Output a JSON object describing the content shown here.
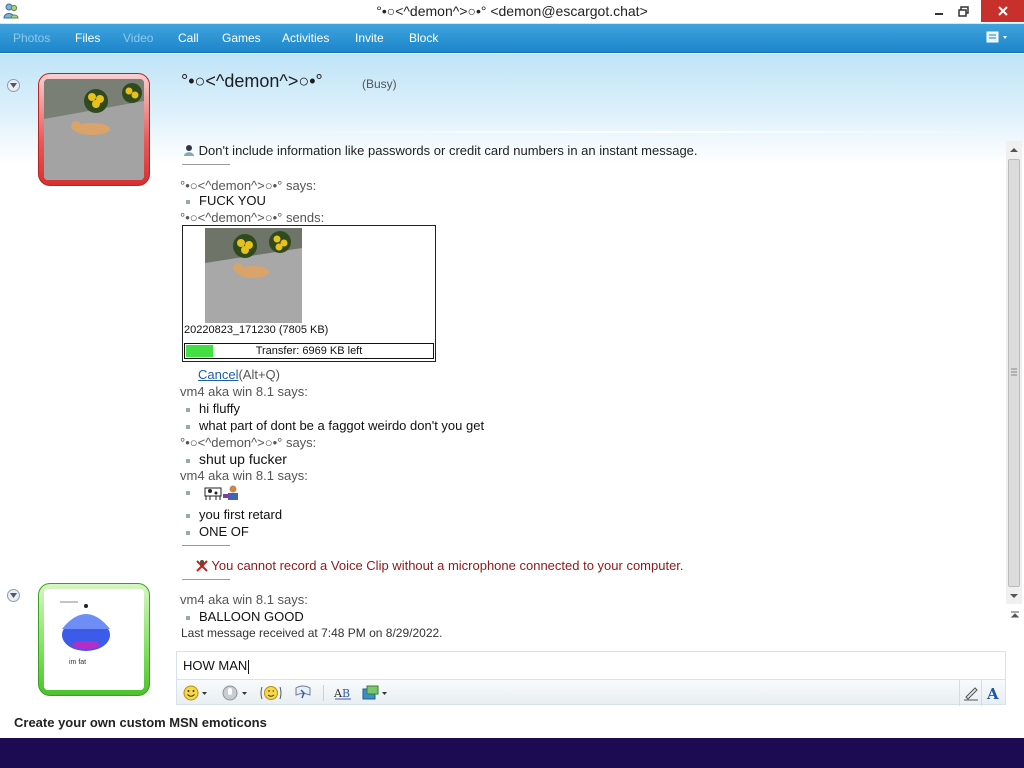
{
  "window": {
    "title": "°•○<^demon^>○•° <demon@escargot.chat>"
  },
  "menu": {
    "items": [
      {
        "label": "Photos",
        "enabled": false
      },
      {
        "label": "Files",
        "enabled": true
      },
      {
        "label": "Video",
        "enabled": false
      },
      {
        "label": "Call",
        "enabled": true
      },
      {
        "label": "Games",
        "enabled": true
      },
      {
        "label": "Activities",
        "enabled": true
      },
      {
        "label": "Invite",
        "enabled": true
      },
      {
        "label": "Block",
        "enabled": true
      }
    ]
  },
  "contact": {
    "name": "°•○<^demon^>○•°",
    "status": "(Busy)"
  },
  "conversation": {
    "privacy_notice": "Don't include information like passwords or credit card numbers in an instant message.",
    "entries": [
      {
        "says": "°•○<^demon^>○•° says:",
        "messages": [
          "FUCK YOU"
        ]
      },
      {
        "says": "°•○<^demon^>○•° sends:"
      }
    ],
    "transfer": {
      "filename": "20220823_171230 (7805 KB)",
      "progress_label": "Transfer: 6969 KB left",
      "progress_fraction": 0.107,
      "cancel_label": "Cancel",
      "cancel_shortcut": "(Alt+Q)"
    },
    "block2": {
      "says": "vm4 aka win 8.1 says:",
      "messages": [
        "hi fluffy",
        "what part of dont be a faggot weirdo don't you get"
      ]
    },
    "block3": {
      "says": "°•○<^demon^>○•° says:",
      "messages": [
        "shut up fucker"
      ]
    },
    "block4": {
      "says": "vm4 aka win 8.1 says:",
      "messages": [
        "you first retard",
        "ONE OF"
      ]
    },
    "voice_clip_warning": "You cannot record a Voice Clip without a microphone connected to your computer.",
    "block5": {
      "says": "vm4 aka win 8.1 says:",
      "messages": [
        "BALLOON GOOD"
      ]
    },
    "last_received": "Last message received at 7:48 PM on 8/29/2022."
  },
  "my_avatar": {
    "caption": "im fat"
  },
  "input": {
    "value": "HOW MAN"
  },
  "footer": {
    "promo": "Create your own custom MSN emoticons"
  },
  "colors": {
    "menubar": "#1d86cb",
    "busy_frame": "#d83030",
    "online_frame": "#4bc22c",
    "progress_fill": "#44e043",
    "warning_text": "#8b1a1a",
    "link": "#1f5fa8",
    "taskbar": "#1c0a52"
  }
}
